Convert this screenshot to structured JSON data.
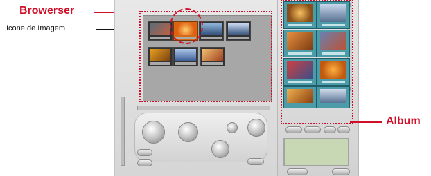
{
  "callouts": {
    "browser": "Browerser",
    "image_icon": "ícone de Imagem",
    "album": "Album"
  },
  "colors": {
    "callout_red": "#d0102a",
    "panel_grey": "#a7a7a7",
    "album_teal": "#4b9ba8",
    "lcd_green": "#c9d8b4"
  }
}
